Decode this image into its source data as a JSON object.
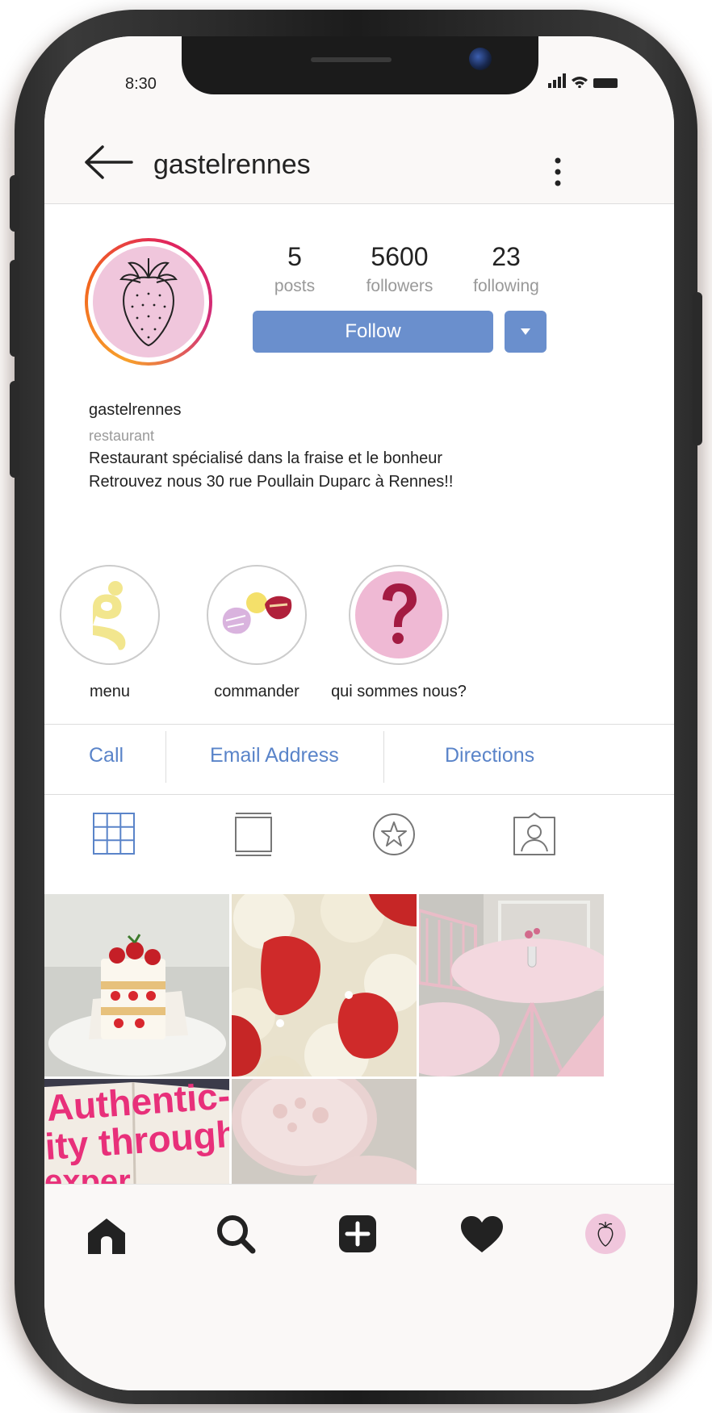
{
  "status_bar": {
    "time": "8:30"
  },
  "header": {
    "username": "gastelrennes"
  },
  "profile": {
    "stats": [
      {
        "value": "5",
        "label": "posts"
      },
      {
        "value": "5600",
        "label": "followers"
      },
      {
        "value": "23",
        "label": "following"
      }
    ],
    "follow_label": "Follow",
    "bio": {
      "name": "gastelrennes",
      "category": "restaurant",
      "lines": [
        "Restaurant spécialisé dans la fraise et le bonheur",
        "Retrouvez nous 30 rue Poullain Duparc à Rennes!!"
      ]
    }
  },
  "highlights": [
    {
      "label": "menu",
      "icon": "letter-g-icon"
    },
    {
      "label": "commander",
      "icon": "candy-icon"
    },
    {
      "label": "qui sommes nous?",
      "icon": "question-mark-icon"
    }
  ],
  "contact": {
    "call": "Call",
    "email": "Email Address",
    "directions": "Directions"
  },
  "tabs": [
    "grid-icon",
    "feed-icon",
    "star-icon",
    "tagged-user-icon"
  ],
  "photos": [
    {
      "subject": "strawberry-cake"
    },
    {
      "subject": "strawberries-cream"
    },
    {
      "subject": "pink-table"
    },
    {
      "subject": "magazine"
    },
    {
      "subject": "strawberry-milk"
    }
  ],
  "photo_text": {
    "magazine_line1": "Authentic-",
    "magazine_line2": "ity through",
    "magazine_line3": "exper"
  },
  "bottom_nav": [
    "home-icon",
    "search-icon",
    "add-post-icon",
    "heart-icon",
    "profile-avatar-icon"
  ],
  "colors": {
    "accent": "#6a8fcd",
    "link": "#5a84c9",
    "pink": "#f0c6dc",
    "bg": "#faf8f7"
  }
}
